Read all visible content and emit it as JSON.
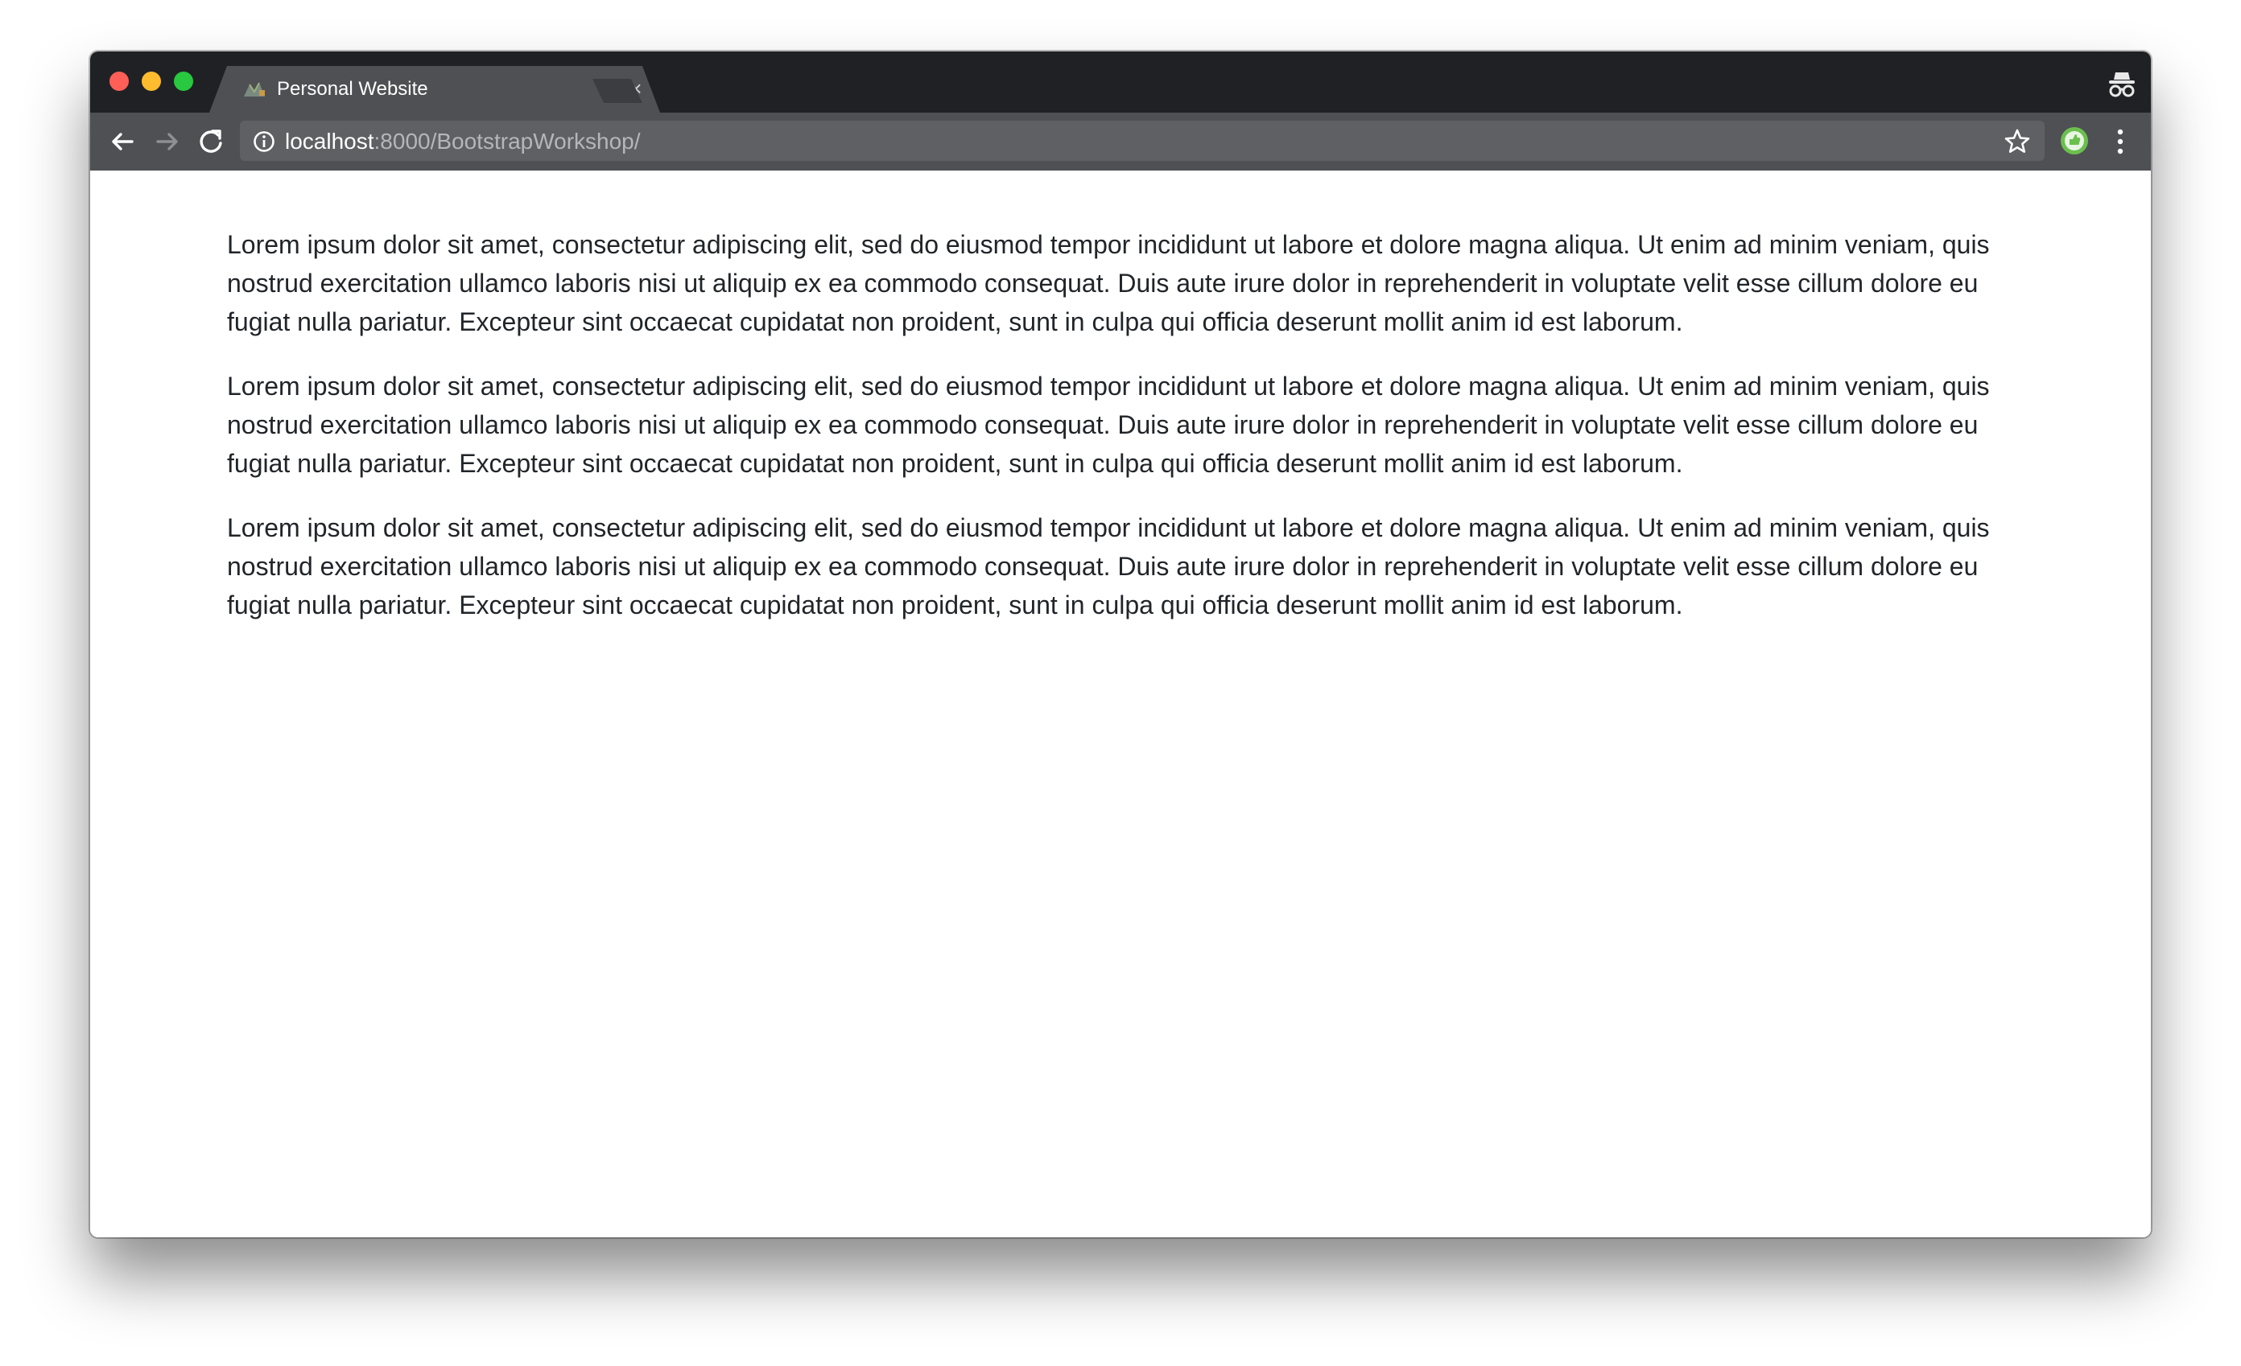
{
  "browser": {
    "tab": {
      "title": "Personal Website",
      "close_glyph": "×"
    },
    "address_bar": {
      "host": "localhost",
      "rest": ":8000/BootstrapWorkshop/"
    },
    "icons": {
      "back": "back-arrow-icon",
      "forward": "forward-arrow-icon",
      "reload": "reload-icon",
      "info": "info-icon",
      "bookmark": "star-icon",
      "extension": "extension-icon",
      "menu": "vertical-dots-icon",
      "incognito": "incognito-icon"
    },
    "colors": {
      "titlebar": "#202124",
      "toolbar": "#4f5054",
      "close": "#ff5f57",
      "minimize": "#febc2e",
      "maximize": "#28c840",
      "extension": "#6bbf4e"
    }
  },
  "page": {
    "paragraphs": [
      "Lorem ipsum dolor sit amet, consectetur adipiscing elit, sed do eiusmod tempor incididunt ut labore et dolore magna aliqua. Ut enim ad minim veniam, quis nostrud exercitation ullamco laboris nisi ut aliquip ex ea commodo consequat. Duis aute irure dolor in reprehenderit in voluptate velit esse cillum dolore eu fugiat nulla pariatur. Excepteur sint occaecat cupidatat non proident, sunt in culpa qui officia deserunt mollit anim id est laborum.",
      "Lorem ipsum dolor sit amet, consectetur adipiscing elit, sed do eiusmod tempor incididunt ut labore et dolore magna aliqua. Ut enim ad minim veniam, quis nostrud exercitation ullamco laboris nisi ut aliquip ex ea commodo consequat. Duis aute irure dolor in reprehenderit in voluptate velit esse cillum dolore eu fugiat nulla pariatur. Excepteur sint occaecat cupidatat non proident, sunt in culpa qui officia deserunt mollit anim id est laborum.",
      "Lorem ipsum dolor sit amet, consectetur adipiscing elit, sed do eiusmod tempor incididunt ut labore et dolore magna aliqua. Ut enim ad minim veniam, quis nostrud exercitation ullamco laboris nisi ut aliquip ex ea commodo consequat. Duis aute irure dolor in reprehenderit in voluptate velit esse cillum dolore eu fugiat nulla pariatur. Excepteur sint occaecat cupidatat non proident, sunt in culpa qui officia deserunt mollit anim id est laborum."
    ]
  }
}
